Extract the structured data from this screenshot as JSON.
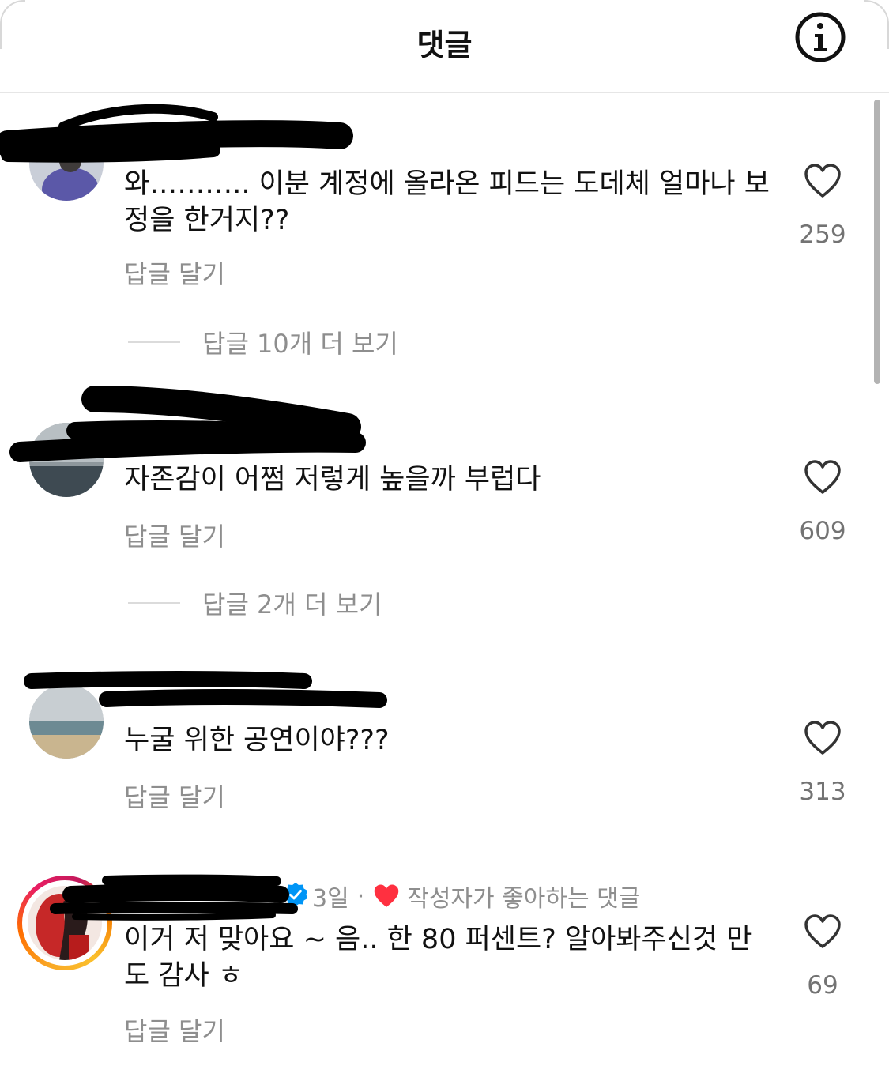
{
  "header": {
    "title": "댓글",
    "info_icon": "info-circle-icon"
  },
  "comments": [
    {
      "text": "와……….. 이분 계정에 올라온 피드는 도데체 얼마나 보정을 한거지??",
      "reply_label": "답글 달기",
      "likes": "259",
      "more_replies": "답글 10개 더 보기"
    },
    {
      "text": "자존감이 어쩜 저렇게 높을까 부럽다",
      "reply_label": "답글 달기",
      "likes": "609",
      "more_replies": "답글 2개 더 보기"
    },
    {
      "text": "누굴 위한 공연이야???",
      "reply_label": "답글 달기",
      "likes": "313"
    },
    {
      "text": "이거 저 맞아요 ~ 음.. 한 80 퍼센트? 알아봐주신것 만도 감사 ㅎ",
      "reply_label": "답글 달기",
      "likes": "69",
      "time": "3일",
      "separator": "·",
      "creator_liked_label": "작성자가 좋아하는 댓글",
      "verified_icon": "verified-badge-icon",
      "heart_color": "#ff3040"
    }
  ],
  "colors": {
    "secondary_text": "#8e8e8e",
    "like_count": "#737373",
    "verified": "#0095f6"
  }
}
